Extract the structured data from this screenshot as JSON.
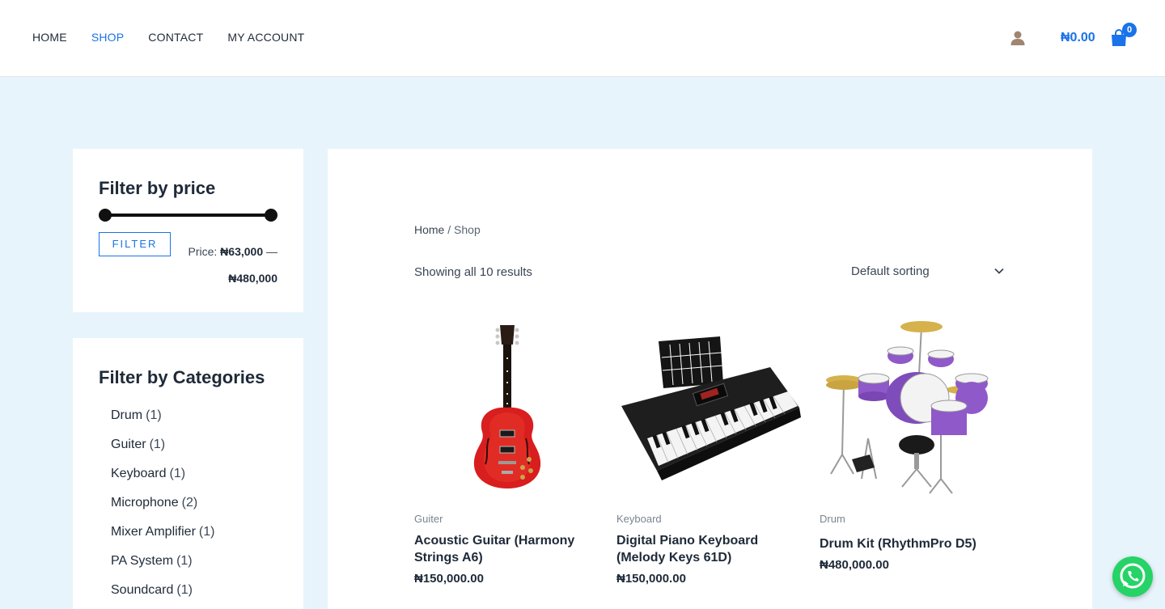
{
  "nav": {
    "items": [
      {
        "label": "HOME",
        "active": false
      },
      {
        "label": "SHOP",
        "active": true
      },
      {
        "label": "CONTACT",
        "active": false
      },
      {
        "label": "MY ACCOUNT",
        "active": false
      }
    ]
  },
  "header": {
    "user_icon": "user-icon",
    "cart_total": "₦0.00",
    "cart_icon": "shopping-bag-icon",
    "cart_count": "0"
  },
  "price_filter": {
    "title": "Filter by price",
    "button_label": "FILTER",
    "price_prefix": "Price:",
    "min_price": "₦63,000",
    "separator": "—",
    "max_price": "₦480,000"
  },
  "category_filter": {
    "title": "Filter by Categories",
    "items": [
      {
        "label": "Drum",
        "count": "(1)"
      },
      {
        "label": "Guiter",
        "count": "(1)"
      },
      {
        "label": "Keyboard",
        "count": "(1)"
      },
      {
        "label": "Microphone",
        "count": "(2)"
      },
      {
        "label": "Mixer Amplifier",
        "count": "(1)"
      },
      {
        "label": "PA System",
        "count": "(1)"
      },
      {
        "label": "Soundcard",
        "count": "(1)"
      }
    ]
  },
  "shop": {
    "breadcrumb_home": "Home",
    "breadcrumb_sep": " / ",
    "breadcrumb_current": "Shop",
    "result_count": "Showing all 10 results",
    "sorting_selected": "Default sorting"
  },
  "products": [
    {
      "category": "Guiter",
      "name": "Acoustic Guitar (Harmony Strings A6)",
      "price": "₦150,000.00",
      "image": "red-electric-guitar"
    },
    {
      "category": "Keyboard",
      "name": "Digital Piano Keyboard (Melody Keys 61D)",
      "price": "₦150,000.00",
      "image": "black-keyboard"
    },
    {
      "category": "Drum",
      "name": "Drum Kit (RhythmPro D5)",
      "price": "₦480,000.00",
      "image": "purple-drum-kit"
    }
  ],
  "colors": {
    "accent": "#1a73e8",
    "page_bg": "#e8f4fc",
    "whatsapp": "#25d366"
  },
  "whatsapp": {
    "icon": "whatsapp-icon"
  }
}
